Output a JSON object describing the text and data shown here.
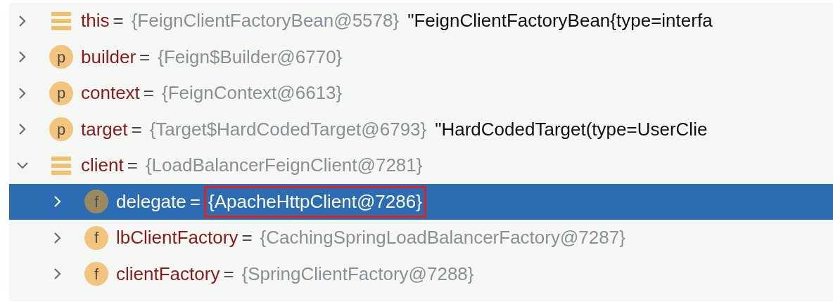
{
  "tree": [
    {
      "name": "this",
      "operator": "=",
      "kind": "stack",
      "value": "{FeignClientFactoryBean@5578}",
      "string": "\"FeignClientFactoryBean{type=interfa",
      "expanded": false,
      "selected": false,
      "boxed": false
    },
    {
      "name": "builder",
      "operator": "=",
      "kind": "badge",
      "badge": "p",
      "value": "{Feign$Builder@6770}",
      "expanded": false,
      "selected": false,
      "boxed": false
    },
    {
      "name": "context",
      "operator": "=",
      "kind": "badge",
      "badge": "p",
      "value": "{FeignContext@6613}",
      "expanded": false,
      "selected": false,
      "boxed": false
    },
    {
      "name": "target",
      "operator": "=",
      "kind": "badge",
      "badge": "p",
      "value": "{Target$HardCodedTarget@6793}",
      "string": "\"HardCodedTarget(type=UserClie",
      "expanded": false,
      "selected": false,
      "boxed": false
    },
    {
      "name": "client",
      "operator": "=",
      "kind": "stack",
      "value": "{LoadBalancerFeignClient@7281}",
      "expanded": true,
      "selected": false,
      "boxed": false,
      "children": [
        {
          "name": "delegate",
          "operator": "=",
          "kind": "badge",
          "badge": "f",
          "value": "{ApacheHttpClient@7286}",
          "expanded": false,
          "selected": true,
          "boxed": true
        },
        {
          "name": "lbClientFactory",
          "operator": "=",
          "kind": "badge",
          "badge": "f",
          "value": "{CachingSpringLoadBalancerFactory@7287}",
          "expanded": false,
          "selected": false,
          "boxed": false
        },
        {
          "name": "clientFactory",
          "operator": "=",
          "kind": "badge",
          "badge": "f",
          "value": "{SpringClientFactory@7288}",
          "expanded": false,
          "selected": false,
          "boxed": false
        }
      ]
    }
  ]
}
